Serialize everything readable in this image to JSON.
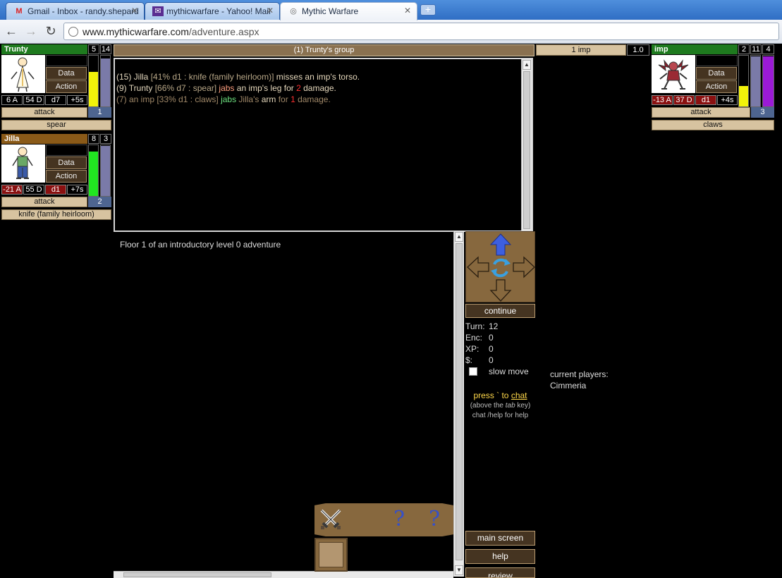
{
  "browser": {
    "tabs": [
      {
        "title": "Gmail - Inbox - randy.shepard",
        "icon": "gmail-icon",
        "active": false
      },
      {
        "title": "mythicwarfare - Yahoo! Mail",
        "icon": "yahoo-mail-icon",
        "active": false
      },
      {
        "title": "Mythic Warfare",
        "icon": "globe-icon",
        "active": true
      }
    ],
    "url_host": "www.mythicwarfare.com",
    "url_path": "/adventure.aspx"
  },
  "party": [
    {
      "name": "Trunty",
      "name_color": "#1e7a1e",
      "num_a": "5",
      "num_b": "14",
      "stats": [
        "6 A",
        "54 D",
        "d7",
        "+5s"
      ],
      "action": "attack",
      "slot": "1",
      "weapon": "spear",
      "hp_fill": 0.68,
      "hp_color": "#f2f20a",
      "mana_fill": 0.95,
      "mana_color": "#7a7aa8"
    },
    {
      "name": "Jilla",
      "name_color": "#8a5a18",
      "num_a": "8",
      "num_b": "3",
      "stats": [
        "-21 A",
        "55 D",
        "d1",
        "+7s"
      ],
      "action": "attack",
      "slot": "2",
      "weapon": "knife (family heirloom)",
      "hp_fill": 0.88,
      "hp_color": "#21e621",
      "mana_fill": 0.98,
      "mana_color": "#7a7aa8"
    }
  ],
  "buttons": {
    "data": "Data",
    "action": "Action"
  },
  "group_header": "(1) Trunty's group",
  "log": [
    [
      {
        "t": "(15) Jilla ",
        "c": "c-name"
      },
      {
        "t": "[41% d1 : knife (family heirloom)]",
        "c": "c-meta"
      },
      {
        "t": " misses an imp's torso.",
        "c": "c-target"
      }
    ],
    [
      {
        "t": "(9) Trunty ",
        "c": "c-name"
      },
      {
        "t": "[66% d7 : spear]",
        "c": "c-meta"
      },
      {
        "t": " jabs",
        "c": "c-verb"
      },
      {
        "t": " an imp's leg for ",
        "c": "c-target"
      },
      {
        "t": "2",
        "c": "c-dmg"
      },
      {
        "t": " damage.",
        "c": "c-target"
      }
    ],
    [
      {
        "t": "(7) an imp [33% d1 : claws] ",
        "c": "c-imp"
      },
      {
        "t": "jabs",
        "c": "c-green"
      },
      {
        "t": " Jilla's ",
        "c": "c-imp"
      },
      {
        "t": "arm",
        "c": "c-target"
      },
      {
        "t": " for ",
        "c": "c-imp"
      },
      {
        "t": "1",
        "c": "c-dmg"
      },
      {
        "t": " damage.",
        "c": "c-imp"
      }
    ]
  ],
  "enemy_header": {
    "label": "1 imp",
    "value": "1.0"
  },
  "enemy": {
    "name": "imp",
    "name_color": "#1e7a1e",
    "num_a": "2",
    "num_b": "11",
    "num_c": "4",
    "stats": [
      "-13 A",
      "37 D",
      "d1",
      "+4s"
    ],
    "action": "attack",
    "slot": "3",
    "weapon": "claws",
    "hp_fill": 0.4,
    "hp_color": "#f2f20a",
    "mana_fill": 0.98,
    "mana_color": "#7a7aa8",
    "extra_fill": 0.98,
    "extra_color": "#9b1ad6"
  },
  "floor_text": "Floor 1 of an introductory level 0 adventure",
  "continue_label": "continue",
  "stats": [
    {
      "k": "Turn:",
      "v": "12"
    },
    {
      "k": "Enc:",
      "v": "0"
    },
    {
      "k": "XP:",
      "v": "0"
    },
    {
      "k": "$:",
      "v": "0"
    }
  ],
  "slow_move_label": "slow move",
  "chat": {
    "press": "press ` to ",
    "link": "chat",
    "line2a": "(above the ",
    "line2tab": "tab",
    "line2b": " key)",
    "line3": "chat /help for help"
  },
  "players": {
    "label": "current players:",
    "names": [
      "Cimmeria"
    ]
  },
  "side_buttons": {
    "main": "main screen",
    "help": "help",
    "review": "review"
  },
  "colors": {
    "panel_brown": "#453421",
    "tan": "#d7c3a0",
    "map_brown": "#87683e",
    "log_border": "#d6d6d6"
  }
}
